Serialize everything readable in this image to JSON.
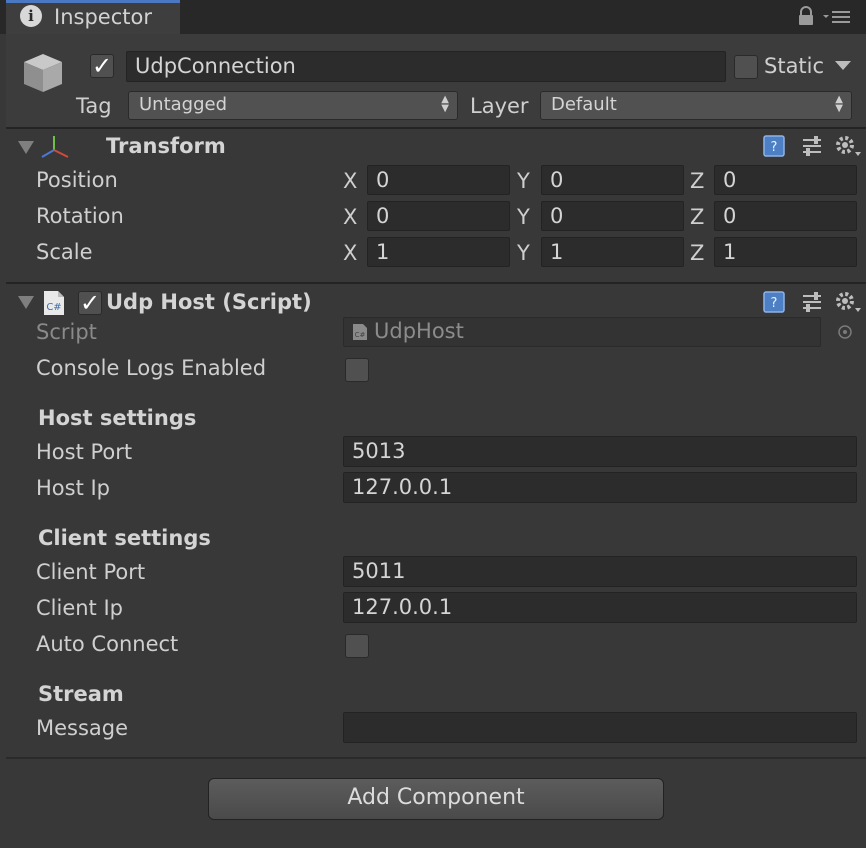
{
  "tab": {
    "label": "Inspector",
    "icon": "info-icon"
  },
  "header": {
    "active": true,
    "name": "UdpConnection",
    "static_label": "Static",
    "static_checked": false,
    "tag_label": "Tag",
    "tag_value": "Untagged",
    "layer_label": "Layer",
    "layer_value": "Default"
  },
  "transform": {
    "title": "Transform",
    "position_label": "Position",
    "rotation_label": "Rotation",
    "scale_label": "Scale",
    "x": "X",
    "y": "Y",
    "z": "Z",
    "position": {
      "x": "0",
      "y": "0",
      "z": "0"
    },
    "rotation": {
      "x": "0",
      "y": "0",
      "z": "0"
    },
    "scale": {
      "x": "1",
      "y": "1",
      "z": "1"
    }
  },
  "udp_host": {
    "title": "Udp Host (Script)",
    "enabled": true,
    "script_label": "Script",
    "script_value": "UdpHost",
    "console_logs_label": "Console Logs Enabled",
    "console_logs_checked": false,
    "host_section": "Host settings",
    "host_port_label": "Host Port",
    "host_port_value": "5013",
    "host_ip_label": "Host Ip",
    "host_ip_value": "127.0.0.1",
    "client_section": "Client settings",
    "client_port_label": "Client Port",
    "client_port_value": "5011",
    "client_ip_label": "Client Ip",
    "client_ip_value": "127.0.0.1",
    "auto_connect_label": "Auto Connect",
    "auto_connect_checked": false,
    "stream_section": "Stream",
    "message_label": "Message",
    "message_value": ""
  },
  "add_component_label": "Add Component",
  "colors": {
    "tab_accent": "#4a78c2",
    "background": "#383838",
    "field_bg": "#2c2c2c",
    "help_icon": "#5b8fd6"
  }
}
